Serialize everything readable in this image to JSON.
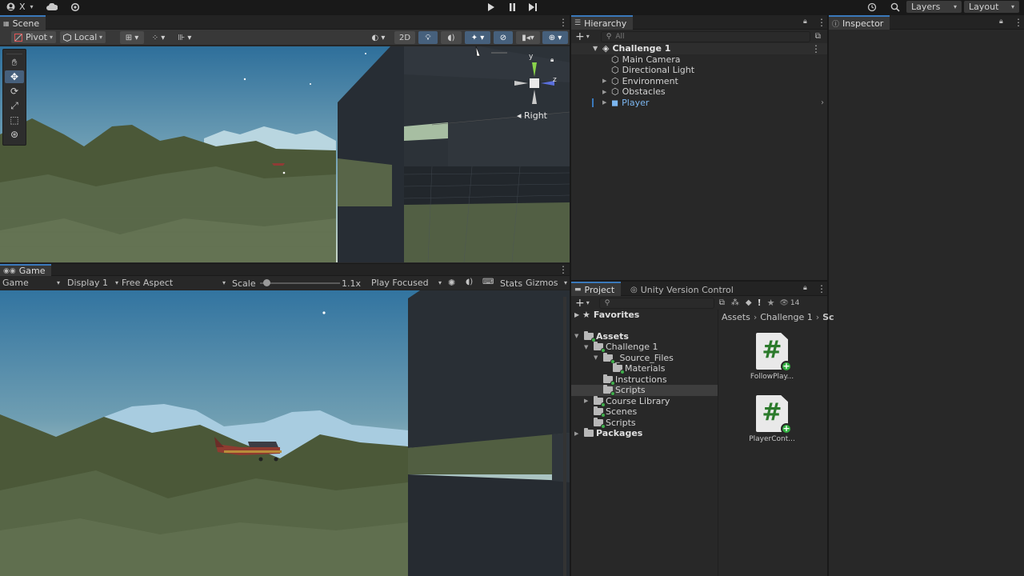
{
  "topbar": {
    "account_label": "X",
    "layers_label": "Layers",
    "layout_label": "Layout"
  },
  "scene": {
    "tab_label": "Scene",
    "pivot_label": "Pivot",
    "local_label": "Local",
    "mode_2d_label": "2D",
    "gizmo_axes": {
      "y": "y",
      "z": "z"
    },
    "gizmo_view_label": "Right",
    "tools": [
      "hand-tool",
      "move-tool",
      "rotate-tool",
      "scale-tool",
      "rect-tool",
      "transform-tool"
    ]
  },
  "game": {
    "tab_label": "Game",
    "view_select": "Game",
    "display_select": "Display 1",
    "aspect_select": "Free Aspect",
    "scale_label": "Scale",
    "scale_value": "1.1x",
    "scale_fraction": 0.08,
    "play_mode_select": "Play Focused",
    "stats_label": "Stats",
    "gizmos_label": "Gizmos"
  },
  "hierarchy": {
    "tab_label": "Hierarchy",
    "search_placeholder": "All",
    "scene_name": "Challenge 1",
    "items": [
      {
        "label": "Main Camera",
        "expandable": false
      },
      {
        "label": "Directional Light",
        "expandable": false
      },
      {
        "label": "Environment",
        "expandable": true
      },
      {
        "label": "Obstacles",
        "expandable": true
      },
      {
        "label": "Player",
        "expandable": true,
        "prefab": true
      }
    ]
  },
  "inspector": {
    "tab_label": "Inspector"
  },
  "project": {
    "tab_label": "Project",
    "vc_tab_label": "Unity Version Control",
    "hidden_count": "14",
    "favorites_label": "Favorites",
    "tree": [
      {
        "label": "Assets",
        "bold": true
      },
      {
        "label": "Challenge 1"
      },
      {
        "label": "_Source_Files"
      },
      {
        "label": "Materials"
      },
      {
        "label": "Instructions"
      },
      {
        "label": "Scripts",
        "selected": true
      },
      {
        "label": "Course Library"
      },
      {
        "label": "Scenes"
      },
      {
        "label": "Scripts"
      },
      {
        "label": "Packages",
        "bold": true
      }
    ],
    "breadcrumb": [
      "Assets",
      "Challenge 1",
      "Sc"
    ],
    "assets": [
      {
        "label": "FollowPlay..."
      },
      {
        "label": "PlayerCont..."
      }
    ]
  },
  "colors": {
    "accent": "#3a79bb",
    "prefab": "#7cb6f0",
    "selection": "#46607c"
  }
}
